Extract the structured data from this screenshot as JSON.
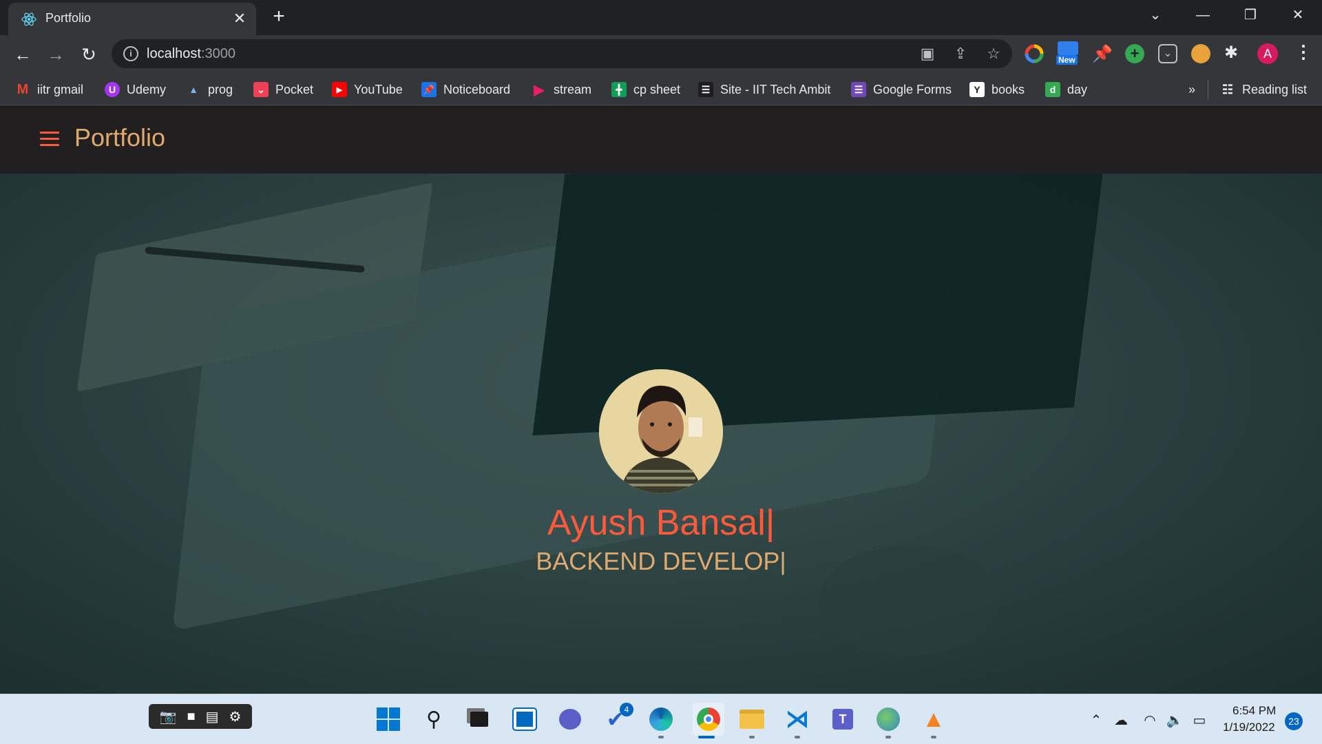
{
  "browser": {
    "tab_title": "Portfolio",
    "url_host": "localhost",
    "url_port": ":3000",
    "bookmarks": [
      {
        "label": "iitr gmail",
        "icon": "gmail-icon",
        "color": "#ea4335"
      },
      {
        "label": "Udemy",
        "icon": "udemy-icon",
        "color": "#a435f0"
      },
      {
        "label": "prog",
        "icon": "prog-icon",
        "color": "#5a9bd5"
      },
      {
        "label": "Pocket",
        "icon": "pocket-icon",
        "color": "#ef4056"
      },
      {
        "label": "YouTube",
        "icon": "youtube-icon",
        "color": "#ff0000"
      },
      {
        "label": "Noticeboard",
        "icon": "pin-icon",
        "color": "#1a73e8"
      },
      {
        "label": "stream",
        "icon": "stream-icon",
        "color": "#e91e63"
      },
      {
        "label": "cp sheet",
        "icon": "sheets-icon",
        "color": "#0f9d58"
      },
      {
        "label": "Site - IIT Tech Ambit",
        "icon": "site-icon",
        "color": "#1e1e1e"
      },
      {
        "label": "Google Forms",
        "icon": "forms-icon",
        "color": "#7248b9"
      },
      {
        "label": "books",
        "icon": "books-icon",
        "color": "#ffffff"
      },
      {
        "label": "day",
        "icon": "day-icon",
        "color": "#34a853"
      }
    ],
    "more_bookmarks": "»",
    "reading_list": "Reading list",
    "profile_initial": "A",
    "new_badge": "New"
  },
  "page": {
    "brand": "Portfolio",
    "name": "Ayush Bansal|",
    "role": "BACKEND DEVELOP|"
  },
  "taskbar": {
    "time": "6:54 PM",
    "date": "1/19/2022",
    "notifications": "23",
    "todo_badge": "4"
  }
}
